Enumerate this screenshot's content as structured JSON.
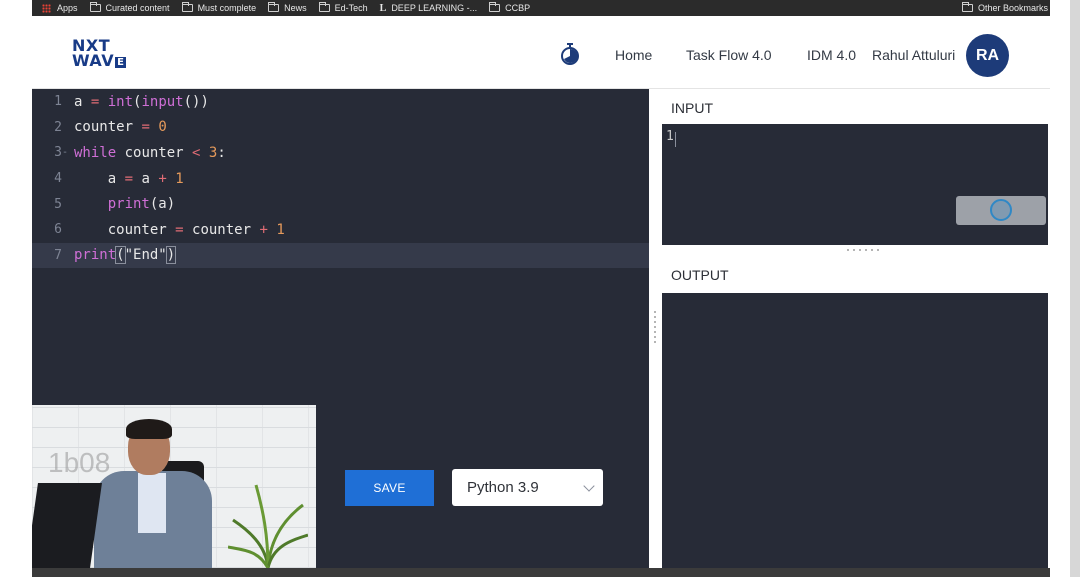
{
  "bookmarks": {
    "apps": "Apps",
    "items": [
      "Curated content",
      "Must complete",
      "News",
      "Ed-Tech",
      "DEEP LEARNING -...",
      "CCBP"
    ],
    "other": "Other Bookmarks"
  },
  "header": {
    "logo_line1": "NXT",
    "logo_line2": "WAV",
    "logo_box": "E",
    "nav": [
      "Home",
      "Task Flow 4.0",
      "IDM 4.0",
      "Rahul Attuluri"
    ],
    "avatar_initials": "RA"
  },
  "editor": {
    "line_numbers": [
      "1",
      "2",
      "3",
      "4",
      "5",
      "6",
      "7"
    ],
    "active_line": 7
  },
  "input_panel": {
    "title": "INPUT",
    "value": "1"
  },
  "output_panel": {
    "title": "OUTPUT"
  },
  "webcam": {
    "overlay_id": "1b08"
  },
  "controls": {
    "save_label": "SAVE",
    "language": "Python 3.9"
  },
  "colors": {
    "brand": "#183b87",
    "editor_bg": "#272b37",
    "save_button": "#1f6fd6",
    "keyword": "#cf6fd6",
    "number": "#e59a5b"
  }
}
